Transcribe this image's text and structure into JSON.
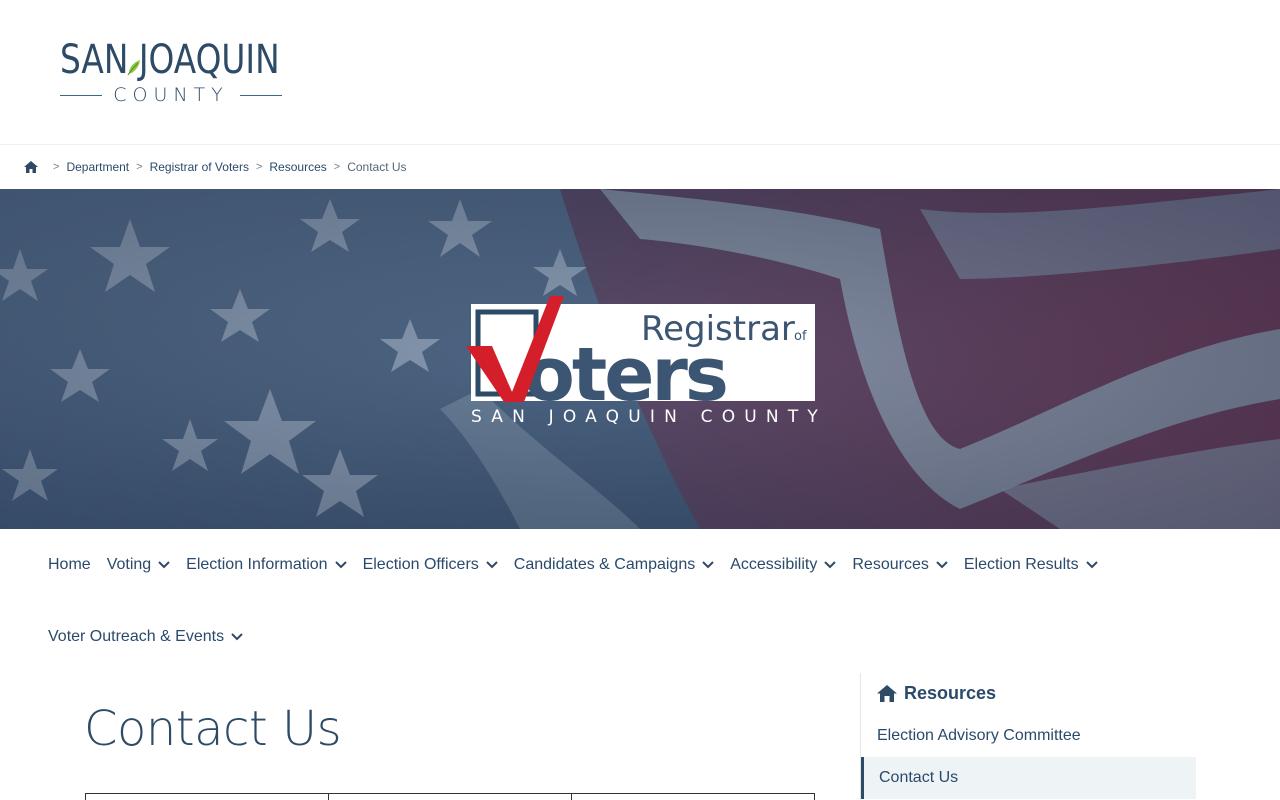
{
  "header": {
    "logo_top": "SAN JOAQUIN",
    "logo_bottom": "COUNTY"
  },
  "breadcrumb": {
    "home_icon": "home-icon",
    "items": [
      "Department",
      "Registrar of Voters",
      "Resources"
    ],
    "current": "Contact Us",
    "separator": ">"
  },
  "hero": {
    "logo_word_small": "Registrar",
    "logo_word_of": "of",
    "logo_word_big": "oters",
    "logo_check_letter": "V",
    "logo_subtitle": "SAN JOAQUIN COUNTY"
  },
  "nav": {
    "items": [
      {
        "label": "Home",
        "has_dropdown": false
      },
      {
        "label": "Voting",
        "has_dropdown": true
      },
      {
        "label": "Election Information",
        "has_dropdown": true
      },
      {
        "label": "Election Officers",
        "has_dropdown": true
      },
      {
        "label": "Candidates & Campaigns",
        "has_dropdown": true
      },
      {
        "label": "Accessibility",
        "has_dropdown": true
      },
      {
        "label": "Resources",
        "has_dropdown": true
      },
      {
        "label": "Election Results",
        "has_dropdown": true
      },
      {
        "label": "Voter Outreach & Events",
        "has_dropdown": true
      }
    ]
  },
  "main": {
    "title": "Contact Us"
  },
  "sidebar": {
    "heading": "Resources",
    "items": [
      {
        "label": "Election Advisory Committee",
        "active": false
      },
      {
        "label": "Contact Us",
        "active": true
      }
    ]
  },
  "colors": {
    "brand_navy": "#2d4a66",
    "check_red": "#d41f2b",
    "text": "#2b4a6b"
  }
}
